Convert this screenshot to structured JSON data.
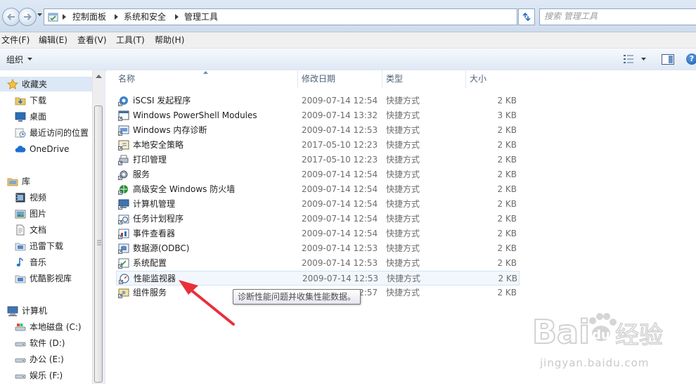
{
  "address_bar": {
    "breadcrumbs": [
      "控制面板",
      "系统和安全",
      "管理工具"
    ],
    "search_placeholder": "搜索 管理工具"
  },
  "menu": [
    "文件(F)",
    "编辑(E)",
    "查看(V)",
    "工具(T)",
    "帮助(H)"
  ],
  "toolbar": {
    "organize_label": "组织",
    "help_label": "?"
  },
  "sidebar": {
    "favorites": {
      "label": "收藏夹",
      "items": [
        "下载",
        "桌面",
        "最近访问的位置",
        "OneDrive"
      ]
    },
    "libraries": {
      "label": "库",
      "items": [
        "视频",
        "图片",
        "文档",
        "迅雷下载",
        "音乐",
        "优酷影视库"
      ]
    },
    "computer": {
      "label": "计算机",
      "items": [
        "本地磁盘 (C:)",
        "软件 (D:)",
        "办公 (E:)",
        "娱乐 (F:)"
      ]
    }
  },
  "columns": {
    "name": "名称",
    "date": "修改日期",
    "type": "类型",
    "size": "大小"
  },
  "files": [
    {
      "name": "iSCSI 发起程序",
      "date": "2009-07-14 12:54",
      "type": "快捷方式",
      "size": "2 KB"
    },
    {
      "name": "Windows PowerShell Modules",
      "date": "2009-07-14 13:32",
      "type": "快捷方式",
      "size": "3 KB"
    },
    {
      "name": "Windows 内存诊断",
      "date": "2009-07-14 12:53",
      "type": "快捷方式",
      "size": "2 KB"
    },
    {
      "name": "本地安全策略",
      "date": "2017-05-10 12:23",
      "type": "快捷方式",
      "size": "2 KB"
    },
    {
      "name": "打印管理",
      "date": "2017-05-10 12:23",
      "type": "快捷方式",
      "size": "2 KB"
    },
    {
      "name": "服务",
      "date": "2009-07-14 12:54",
      "type": "快捷方式",
      "size": "2 KB"
    },
    {
      "name": "高级安全 Windows 防火墙",
      "date": "2009-07-14 12:54",
      "type": "快捷方式",
      "size": "2 KB"
    },
    {
      "name": "计算机管理",
      "date": "2009-07-14 12:54",
      "type": "快捷方式",
      "size": "2 KB"
    },
    {
      "name": "任务计划程序",
      "date": "2009-07-14 12:54",
      "type": "快捷方式",
      "size": "2 KB"
    },
    {
      "name": "事件查看器",
      "date": "2009-07-14 12:54",
      "type": "快捷方式",
      "size": "2 KB"
    },
    {
      "name": "数据源(ODBC)",
      "date": "2009-07-14 12:53",
      "type": "快捷方式",
      "size": "2 KB"
    },
    {
      "name": "系统配置",
      "date": "2009-07-14 12:53",
      "type": "快捷方式",
      "size": "2 KB"
    },
    {
      "name": "性能监视器",
      "date": "2009-07-14 12:53",
      "type": "快捷方式",
      "size": "2 KB"
    },
    {
      "name": "组件服务",
      "date": "2009-07-14 12:57",
      "type": "快捷方式",
      "size": "2 KB"
    }
  ],
  "tooltip": "诊断性能问题并收集性能数据。",
  "watermark": {
    "text": "Baidu经验",
    "url": "jingyan.baidu.com"
  },
  "colors": {
    "selection": "#dce8f6",
    "hover": "#f2f7fd",
    "annotation_arrow": "#e8303a"
  }
}
